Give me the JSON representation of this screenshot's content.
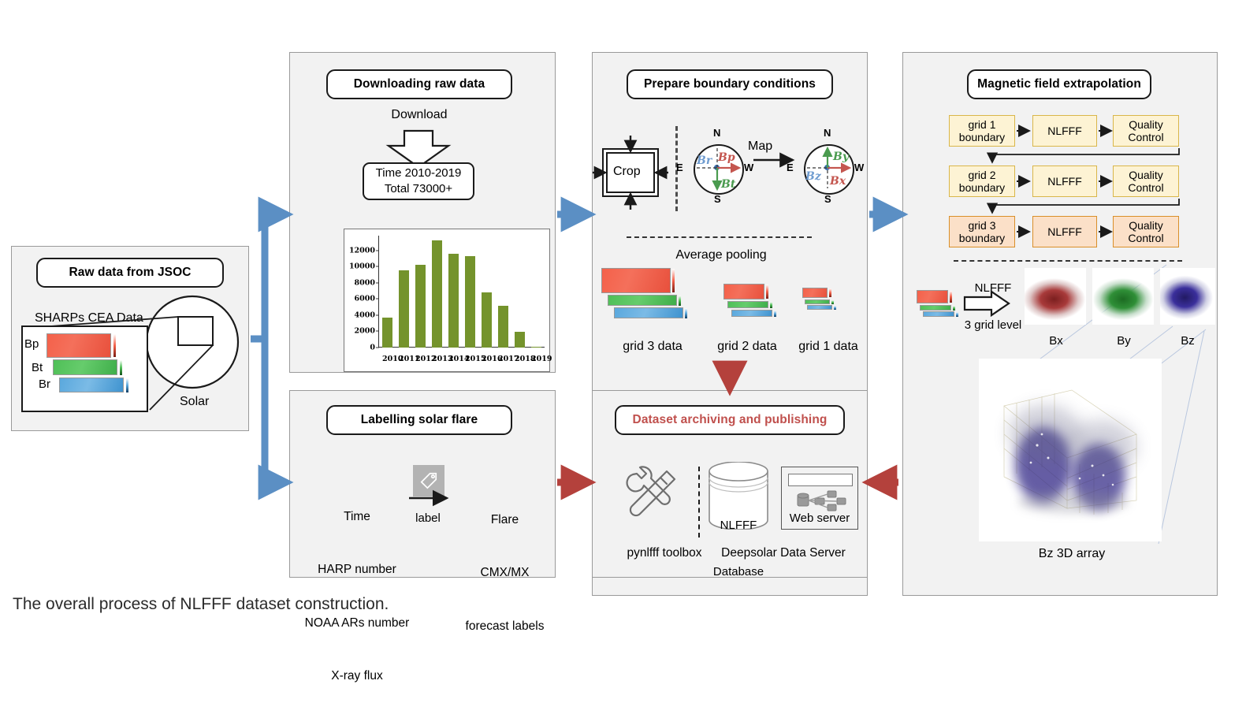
{
  "caption": "The overall process of NLFFF dataset construction.",
  "colors": {
    "panel_bg": "#f2f2f2",
    "blue_arrow": "#5b8fc4",
    "red_arrow": "#b4413c",
    "bar_green": "#74932c",
    "header_red": "#c0504d",
    "grid_yellow": "#fdf3d4",
    "grid_orange": "#fbe0c8"
  },
  "panels": {
    "raw_data": {
      "header": "Raw data from JSOC",
      "subtitle": "SHARPs CEA Data",
      "solar_label": "Solar",
      "bands": [
        "Bp",
        "Bt",
        "Br"
      ]
    },
    "downloading": {
      "header": "Downloading raw data",
      "download_label": "Download",
      "summary_line1": "Time 2010-2019",
      "summary_line2": "Total  73000+"
    },
    "boundary": {
      "header": "Prepare boundary conditions",
      "crop_label": "Crop",
      "map_label": "Map",
      "pooling_label": "Average pooling",
      "compass_left": {
        "north": "N",
        "south": "S",
        "east": "E",
        "west": "W",
        "radial": "Br",
        "poloidal": "Bp",
        "toroidal": "Bt"
      },
      "compass_right": {
        "north": "N",
        "south": "S",
        "east": "E",
        "west": "W",
        "bz": "Bz",
        "bx": "Bx",
        "by": "By"
      },
      "grid_labels": [
        "grid 3 data",
        "grid 2 data",
        "grid 1 data"
      ]
    },
    "extrapolation": {
      "header": "Magnetic field extrapolation",
      "rows": [
        {
          "boundary": "grid 1\nboundary",
          "solver": "NLFFF",
          "check": "Quality\nControl"
        },
        {
          "boundary": "grid 2\nboundary",
          "solver": "NLFFF",
          "check": "Quality\nControl"
        },
        {
          "boundary": "grid 3\nboundary",
          "solver": "NLFFF",
          "check": "Quality\nControl"
        }
      ],
      "nlfff_label": "NLFFF",
      "grid_level_label": "3 grid level",
      "component_labels": [
        "Bx",
        "By",
        "Bz"
      ],
      "volume_label": "Bz  3D  array"
    },
    "labelling": {
      "header": "Labelling solar flare",
      "inputs": [
        "Time",
        "HARP number",
        "NOAA ARs number",
        "X-ray flux"
      ],
      "arrow_label": "label",
      "outputs": [
        "Flare",
        "CMX/MX",
        "forecast labels"
      ]
    },
    "archiving": {
      "header": "Dataset archiving and publishing",
      "toolbox_label": "pynlfff toolbox",
      "server_label": "Deepsolar Data Server",
      "database_line1": "NLFFF",
      "database_line2": "Database",
      "webserver_label": "Web server"
    }
  },
  "chart_data": {
    "type": "bar",
    "title": "",
    "xlabel": "",
    "ylabel": "",
    "categories": [
      "2010",
      "2011",
      "2012",
      "2013",
      "2014",
      "2015",
      "2016",
      "2017",
      "2018",
      "2019"
    ],
    "values": [
      3650,
      9550,
      10200,
      13200,
      11550,
      11250,
      6800,
      5200,
      1950,
      100
    ],
    "yticks": [
      0,
      2000,
      4000,
      6000,
      8000,
      10000,
      12000
    ],
    "ylim": [
      0,
      13800
    ],
    "grid": false,
    "legend": false,
    "series_color": "#74932c"
  }
}
